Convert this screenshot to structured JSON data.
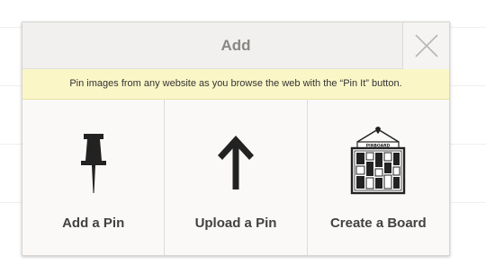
{
  "modal": {
    "title": "Add",
    "notice": "Pin images from any website as you browse the web with the “Pin It” button.",
    "options": [
      {
        "label": "Add a Pin",
        "icon": "pushpin-icon"
      },
      {
        "label": "Upload a Pin",
        "icon": "up-arrow-icon"
      },
      {
        "label": "Create a Board",
        "icon": "pinboard-icon"
      }
    ],
    "board_icon_text": "PINBOARD"
  },
  "colors": {
    "header_bg": "#f1f0ee",
    "title_text": "#8a8785",
    "notice_bg": "#fbf6c6",
    "icon": "#222222",
    "label_text": "#444240"
  }
}
